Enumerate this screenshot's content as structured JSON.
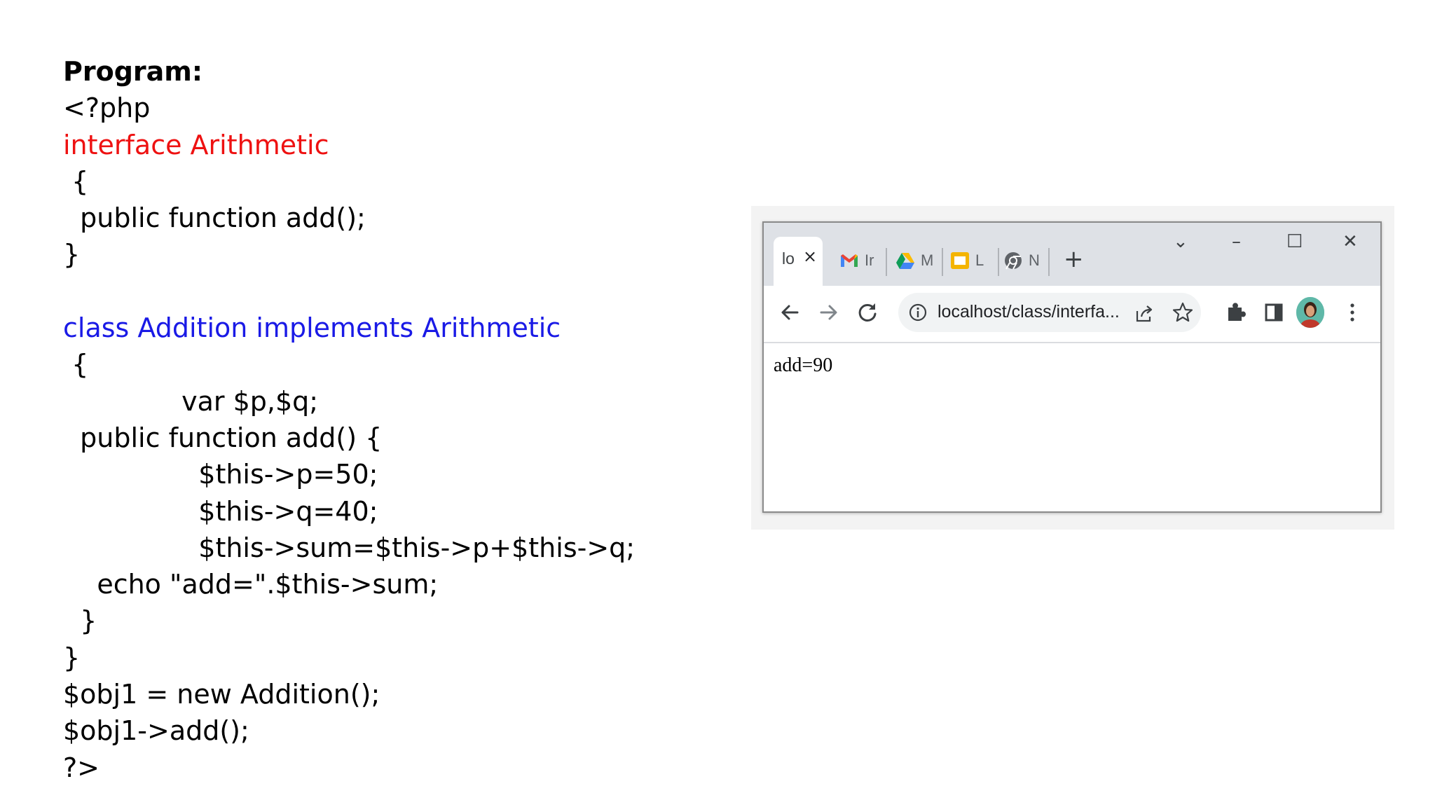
{
  "code": {
    "heading": "Program:",
    "lines": [
      {
        "text": "<?php",
        "color": "#000000"
      },
      {
        "text": "interface Arithmetic",
        "color": "#ee1111"
      },
      {
        "text": " {",
        "color": "#000000"
      },
      {
        "text": "  public function add();",
        "color": "#000000"
      },
      {
        "text": "}",
        "color": "#000000"
      },
      {
        "text": "",
        "color": "#000000"
      },
      {
        "text": "class Addition implements Arithmetic",
        "color": "#1a1ae6"
      },
      {
        "text": " {",
        "color": "#000000"
      },
      {
        "text": "              var $p,$q;",
        "color": "#000000"
      },
      {
        "text": "  public function add() {",
        "color": "#000000"
      },
      {
        "text": "                $this->p=50;",
        "color": "#000000"
      },
      {
        "text": "                $this->q=40;",
        "color": "#000000"
      },
      {
        "text": "                $this->sum=$this->p+$this->q;",
        "color": "#000000"
      },
      {
        "text": "    echo \"add=\".$this->sum;",
        "color": "#000000"
      },
      {
        "text": "  }",
        "color": "#000000"
      },
      {
        "text": "}",
        "color": "#000000"
      },
      {
        "text": "$obj1 = new Addition();",
        "color": "#000000"
      },
      {
        "text": "$obj1->add();",
        "color": "#000000"
      },
      {
        "text": "?>",
        "color": "#000000"
      }
    ]
  },
  "browser": {
    "tabs": {
      "active_title": "lo",
      "active_close": "×",
      "gmail_title": "Ir",
      "drive_title": "M",
      "slides_title": "L",
      "chrome_title": "N",
      "new_tab": "+"
    },
    "window_controls": {
      "dropdown": "⌄",
      "minimize": "–",
      "maximize": "☐",
      "close": "✕"
    },
    "address_bar": {
      "url": "localhost/class/interfa..."
    },
    "page_output": "add=90",
    "colors": {
      "tabstrip": "#dee1e6",
      "omnibox": "#f1f3f4"
    }
  }
}
